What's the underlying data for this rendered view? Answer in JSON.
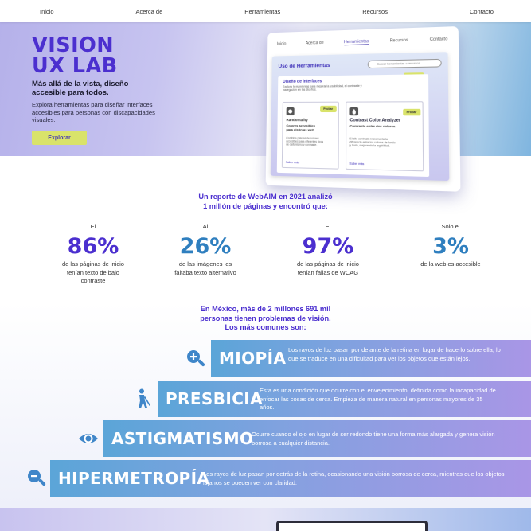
{
  "nav": {
    "items": [
      "Inicio",
      "Acerca de",
      "Herramientas",
      "Recursos",
      "Contacto"
    ]
  },
  "hero": {
    "title_line1": "VISION",
    "title_line2": "UX LAB",
    "subtitle": "Más allá de la vista, diseño accesible para todos.",
    "description": "Explora herramientas para diseñar interfaces accesibles para personas con discapacidades visuales.",
    "button_label": "Explorar"
  },
  "mockup": {
    "nav": [
      "Inicio",
      "Acerca de",
      "Herramientas",
      "Recursos",
      "Contacto"
    ],
    "title": "Uso de Herramientas",
    "search_placeholder": "Buscar herramientas o recursos",
    "tag_top": "Reenviar",
    "section_title": "Diseño de interfaces",
    "section_desc": "Explora herramientas para mejorar la usabilidad, el contraste y navegación en tus diseños.",
    "card1": {
      "tag": "Probar",
      "name": "Randomality",
      "heading": "Colores accesibles para distintas web",
      "body": "Combina paletas de colores accesibles para diferentes tipos de daltonismo y contraste.",
      "link": "Saber más"
    },
    "card2": {
      "tag": "Probar",
      "name": "Contrast Color Analyzer",
      "heading": "Contraste entre dos colores.",
      "body": "El alto contraste incrementa la diferencia entre los colores de fondo y texto, mejorando la legibilidad.",
      "link": "Saber más"
    }
  },
  "stats": {
    "intro_line1": "Un reporte de WebAIM en 2021 analizó",
    "intro_line2": "1 millón de páginas y encontró que:",
    "items": [
      {
        "pre": "El",
        "value": "86%",
        "desc": "de las páginas de inicio tenían texto de bajo contraste",
        "color": "#4b2fcf"
      },
      {
        "pre": "Al",
        "value": "26%",
        "desc": "de las imágenes les faltaba texto alternativo",
        "color": "#2f7fbf"
      },
      {
        "pre": "El",
        "value": "97%",
        "desc": "de las páginas de inicio tenían fallas de WCAG",
        "color": "#4b2fcf"
      },
      {
        "pre": "Solo el",
        "value": "3%",
        "desc": "de la web es accesible",
        "color": "#2f7fbf"
      }
    ]
  },
  "mexico": {
    "title_line1": "En México, más de 2 millones 691 mil",
    "title_line2": "personas tienen problemas de visión.",
    "title_line3": "Los más comunes son:",
    "conditions": [
      {
        "name": "MIOPÍA",
        "icon": "magnifier-plus-icon",
        "text": "Los rayos de luz pasan por delante de la retina en lugar de hacerlo sobre ella, lo que se traduce en una dificultad para ver los objetos que están lejos."
      },
      {
        "name": "PRESBICIA",
        "icon": "person-cane-icon",
        "text": "Esta es una condición que ocurre con el envejecimiento, definida como la incapacidad de enfocar las cosas de cerca. Empieza de manera natural en personas mayores de 35 años."
      },
      {
        "name": "ASTIGMATISMO",
        "icon": "eye-icon",
        "text": "Ocurre cuando el ojo en lugar de ser redondo tiene una forma más alargada y genera visión borrosa a cualquier distancia."
      },
      {
        "name": "HIPERMETROPÍA",
        "icon": "magnifier-minus-icon",
        "text": "Los rayos de luz pasan por detrás de la retina, ocasionando una visión borrosa de cerca, mientras que los objetos lejanos se pueden ver con claridad."
      }
    ]
  },
  "colors": {
    "accent": "#4b2fcf",
    "accent_blue": "#2f7fbf",
    "button": "#d9e36a"
  }
}
